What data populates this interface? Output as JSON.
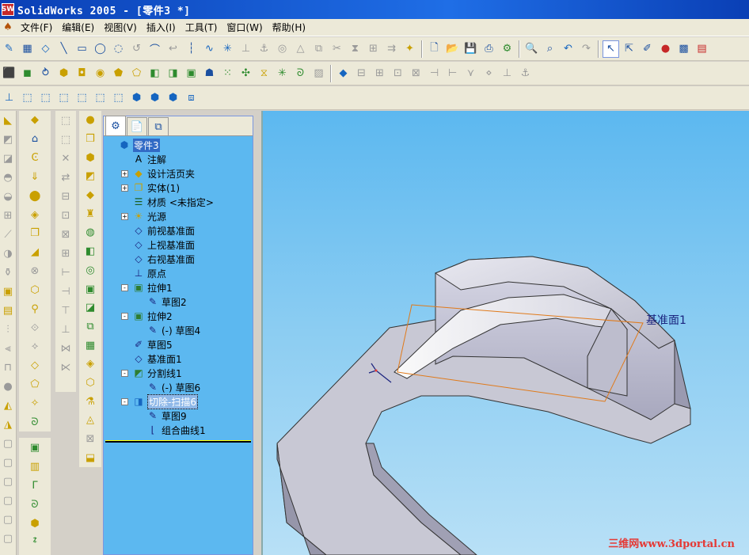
{
  "window": {
    "title": "SolidWorks 2005 - [零件3 *]",
    "app_icon": "sw-logo-icon"
  },
  "menu": {
    "items": [
      "文件(F)",
      "编辑(E)",
      "视图(V)",
      "插入(I)",
      "工具(T)",
      "窗口(W)",
      "帮助(H)"
    ]
  },
  "feature_tree": {
    "tabs": [
      "feature-manager-icon",
      "property-manager-icon",
      "configuration-manager-icon"
    ],
    "nodes": [
      {
        "label": "零件3",
        "icon": "part-icon",
        "indent": 0,
        "expander": "",
        "selected": true
      },
      {
        "label": "注解",
        "icon": "annotation-icon",
        "indent": 1,
        "expander": ""
      },
      {
        "label": "设计活页夹",
        "icon": "design-binder-icon",
        "indent": 1,
        "expander": "+"
      },
      {
        "label": "实体(1)",
        "icon": "solid-bodies-icon",
        "indent": 1,
        "expander": "+"
      },
      {
        "label": "材质 <未指定>",
        "icon": "material-icon",
        "indent": 1,
        "expander": ""
      },
      {
        "label": "光源",
        "icon": "lighting-icon",
        "indent": 1,
        "expander": "+"
      },
      {
        "label": "前视基准面",
        "icon": "plane-icon",
        "indent": 1,
        "expander": ""
      },
      {
        "label": "上视基准面",
        "icon": "plane-icon",
        "indent": 1,
        "expander": ""
      },
      {
        "label": "右视基准面",
        "icon": "plane-icon",
        "indent": 1,
        "expander": ""
      },
      {
        "label": "原点",
        "icon": "origin-icon",
        "indent": 1,
        "expander": ""
      },
      {
        "label": "拉伸1",
        "icon": "extrude-icon",
        "indent": 1,
        "expander": "-"
      },
      {
        "label": "草图2",
        "icon": "sketch-icon",
        "indent": 2,
        "expander": ""
      },
      {
        "label": "拉伸2",
        "icon": "extrude-icon",
        "indent": 1,
        "expander": "-"
      },
      {
        "label": "(-) 草图4",
        "icon": "sketch-icon",
        "indent": 2,
        "expander": ""
      },
      {
        "label": "草图5",
        "icon": "sketch-3d-icon",
        "indent": 1,
        "expander": ""
      },
      {
        "label": "基准面1",
        "icon": "plane-icon",
        "indent": 1,
        "expander": ""
      },
      {
        "label": "分割线1",
        "icon": "split-line-icon",
        "indent": 1,
        "expander": "-"
      },
      {
        "label": "(-) 草图6",
        "icon": "sketch-icon",
        "indent": 2,
        "expander": ""
      },
      {
        "label": "切除-扫描6",
        "icon": "swept-cut-icon",
        "indent": 1,
        "expander": "-",
        "highlighted": true
      },
      {
        "label": "草图9",
        "icon": "sketch-icon",
        "indent": 2,
        "expander": ""
      },
      {
        "label": "组合曲线1",
        "icon": "composite-curve-icon",
        "indent": 2,
        "expander": ""
      }
    ]
  },
  "viewport": {
    "plane_label": "基准面1",
    "watermark": "三维网www.3dportal.cn"
  },
  "colors": {
    "titlebar": "#1f6ee6",
    "viewport_top": "#5cb8f0",
    "viewport_bottom": "#b8e0f6",
    "plane_outline": "#e07a1a",
    "watermark": "#e53935"
  }
}
